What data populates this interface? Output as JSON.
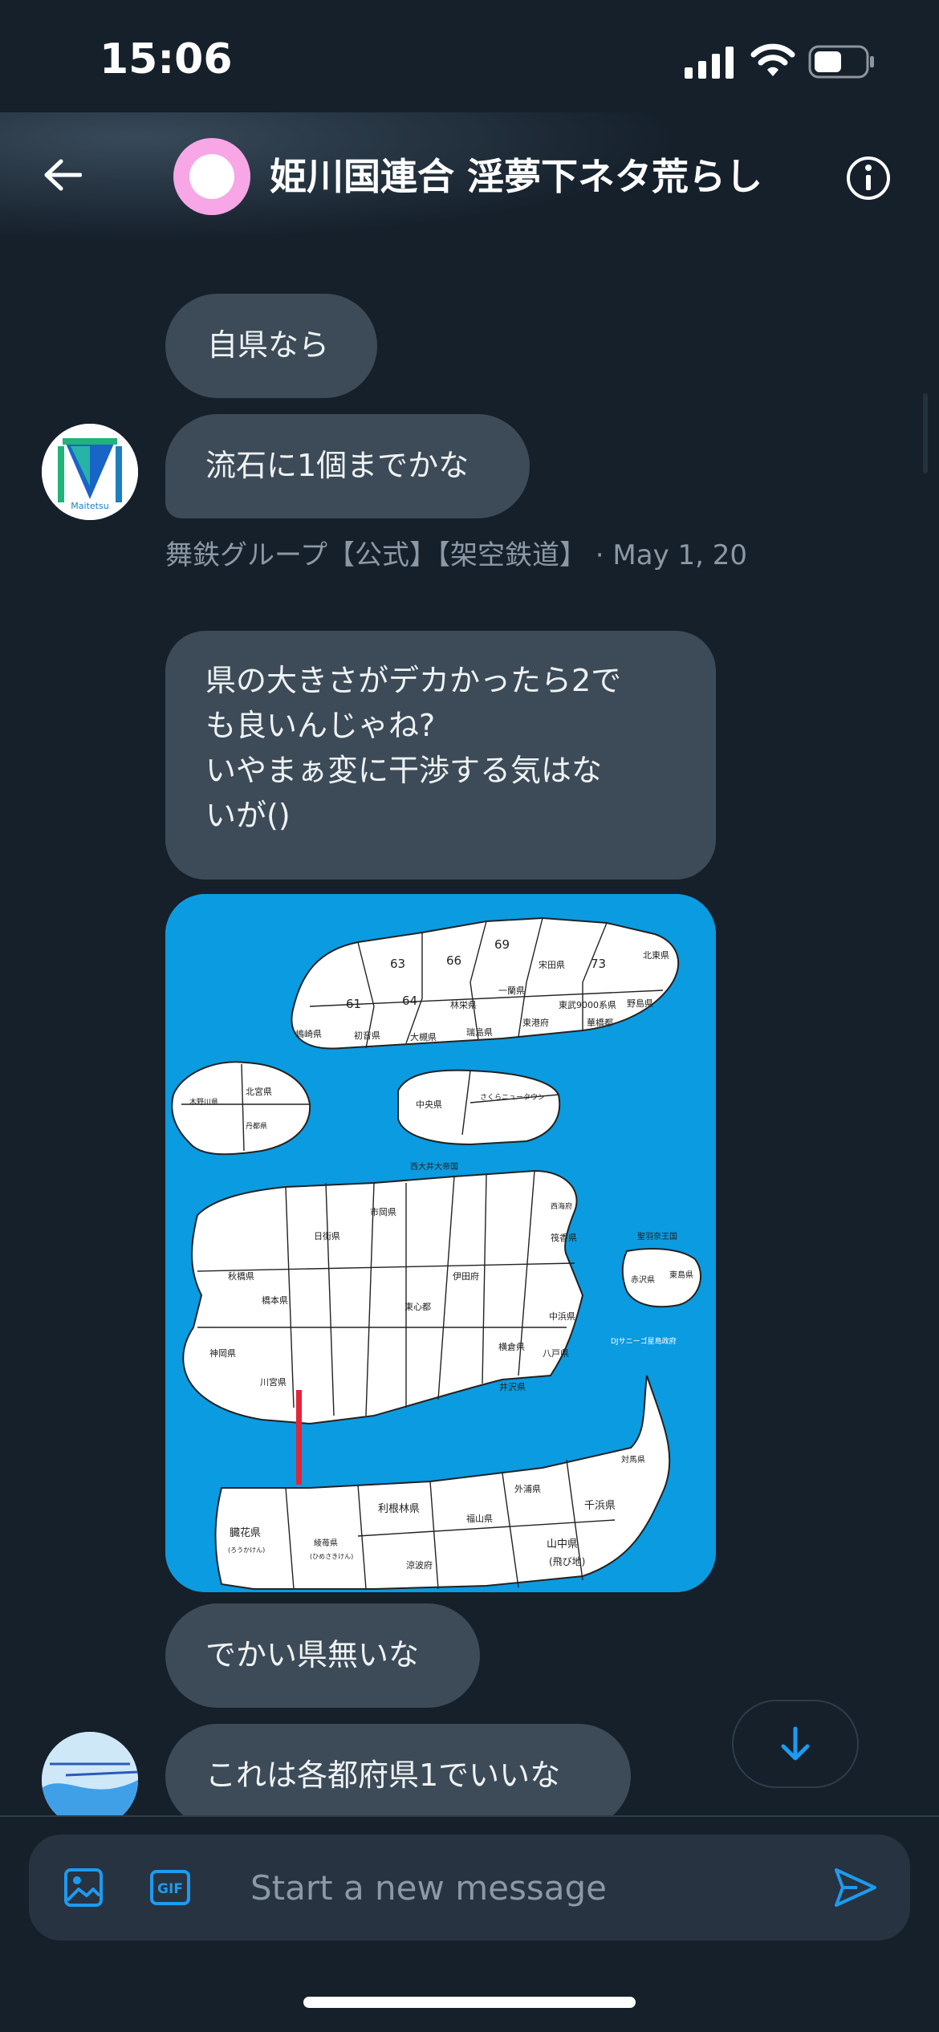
{
  "status_bar": {
    "time": "15:06",
    "battery_level": 0.55
  },
  "header": {
    "title": "姫川国連合 淫夢下ネタ荒らし",
    "avatar_color": "#f7a6e6"
  },
  "messages": [
    {
      "text": "自県なら"
    },
    {
      "text": "流石に1個までかな"
    },
    {
      "lines": [
        "県の大きさがデカかったら2で",
        "も良いんじゃね?",
        "いやまぁ変に干渉する気はな",
        "いが()"
      ]
    },
    {
      "text": "でかい県無いな"
    },
    {
      "text": "これは各都府県1でいいな"
    }
  ],
  "meta": {
    "sender": "舞鉄グループ【公式】【架空鉄道】",
    "separator": " · ",
    "date": "May 1, 20"
  },
  "avatar_text": "Maitetsu",
  "map": {
    "regions": [
      "63",
      "66",
      "69",
      "73",
      "61",
      "64",
      "北東県",
      "宋田県",
      "一蘭県",
      "林栄県",
      "東武9000系県",
      "野島県",
      "嶋崎県",
      "初音県",
      "大槻県",
      "瑞島県",
      "東港府",
      "華橋都",
      "北宮県",
      "丹都県",
      "木野川県",
      "中央県",
      "さくらニュータウン",
      "西大井大帝国",
      "市岡県",
      "日街県",
      "西海府",
      "筏香県",
      "聖羽奈王国",
      "赤沢県",
      "東島県",
      "秋橋県",
      "橋本県",
      "伊田府",
      "東心都",
      "中浜県",
      "神岡県",
      "八戸県",
      "横倉県",
      "川宮県",
      "井沢県",
      "DJサニーゴ星島政府",
      "利根林県",
      "外浦県",
      "福山県",
      "千浜県",
      "対馬県",
      "臓花県",
      "(ろうかけん)",
      "綾苺県",
      "(ひめさきけん)",
      "涼波府",
      "山中県",
      "(飛び地)"
    ]
  },
  "composer": {
    "placeholder": "Start a new message",
    "gif_label": "GIF"
  },
  "colors": {
    "background": "#15202b",
    "bubble": "#3d4b58",
    "accent": "#1d9bf0",
    "map_sea": "#0b9be1"
  }
}
